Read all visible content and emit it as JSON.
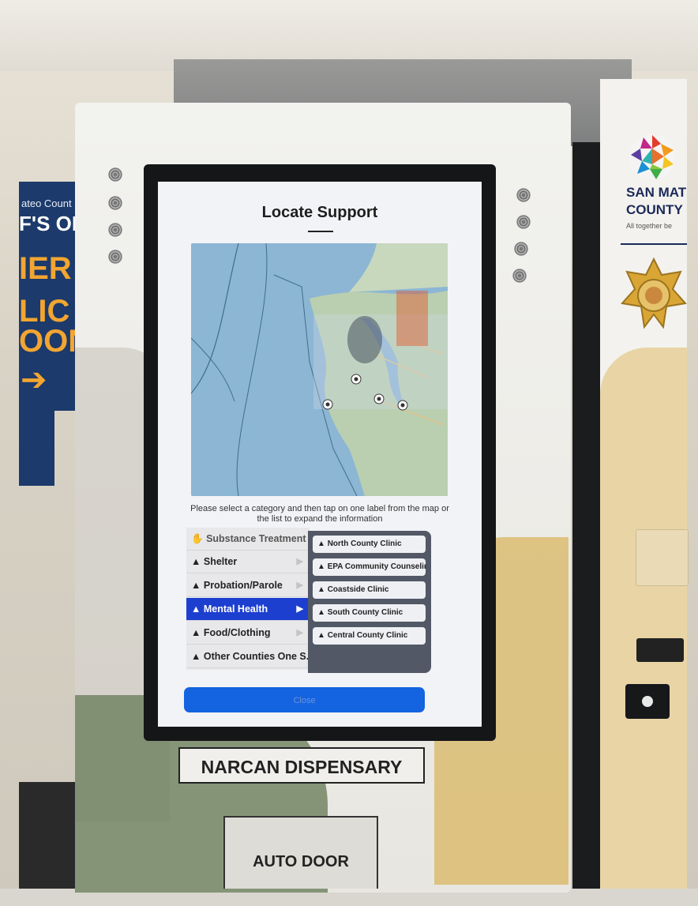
{
  "screen": {
    "title": "Locate Support",
    "instructions": "Please select a category and then tap on one label from the map or the list to expand the information",
    "categories": [
      {
        "label": "Substance Treatment",
        "icon": "hand-icon",
        "active": false
      },
      {
        "label": "Shelter",
        "icon": "triangle-icon",
        "active": false
      },
      {
        "label": "Probation/Parole",
        "icon": "triangle-icon",
        "active": false
      },
      {
        "label": "Mental Health",
        "icon": "triangle-icon",
        "active": true
      },
      {
        "label": "Food/Clothing",
        "icon": "triangle-icon",
        "active": false
      },
      {
        "label": "Other Counties One S.op",
        "icon": "triangle-icon",
        "active": false
      }
    ],
    "locations": [
      {
        "label": "North County Clinic"
      },
      {
        "label": "EPA Community Counseling"
      },
      {
        "label": "Coastside Clinic"
      },
      {
        "label": "South County Clinic"
      },
      {
        "label": "Central County Clinic"
      }
    ],
    "close_label": "Close",
    "active_color": "#1d3fd0",
    "button_color": "#1463e0"
  },
  "kiosk": {
    "label": "NARCAN DISPENSARY",
    "door_label": "AUTO DOOR"
  },
  "left_sign": {
    "line1": "ateo Count",
    "line2": "F'S OF",
    "line3": "IER",
    "line4": "LIC",
    "line5": "OON"
  },
  "right_kiosk": {
    "brand_line1": "SAN MAT",
    "brand_line2": "COUNTY",
    "tagline": "All together be"
  }
}
